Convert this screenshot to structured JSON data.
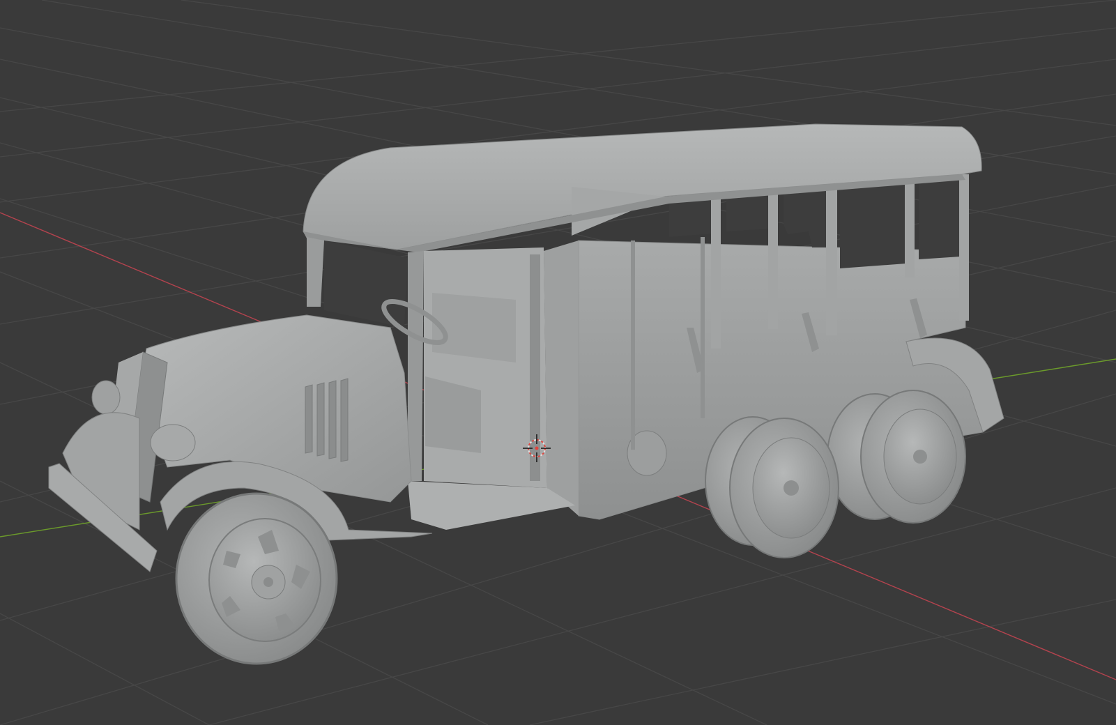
{
  "viewport": {
    "background": "#3a3a3a",
    "grid_color": "#464646",
    "x_axis_color": "#b4434e",
    "y_axis_color": "#6b9a2b",
    "cursor_colors": [
      "#e0e0e0",
      "#e0453e"
    ]
  },
  "model": {
    "body_color": "#a4a6a6",
    "shadow_color": "#7d7f80",
    "highlight_color": "#c0c1c1",
    "tire_color": "#9a9c9c"
  },
  "objects": [
    {
      "icon": "truck-mesh-icon"
    },
    {
      "icon": "3d-cursor-icon"
    }
  ]
}
